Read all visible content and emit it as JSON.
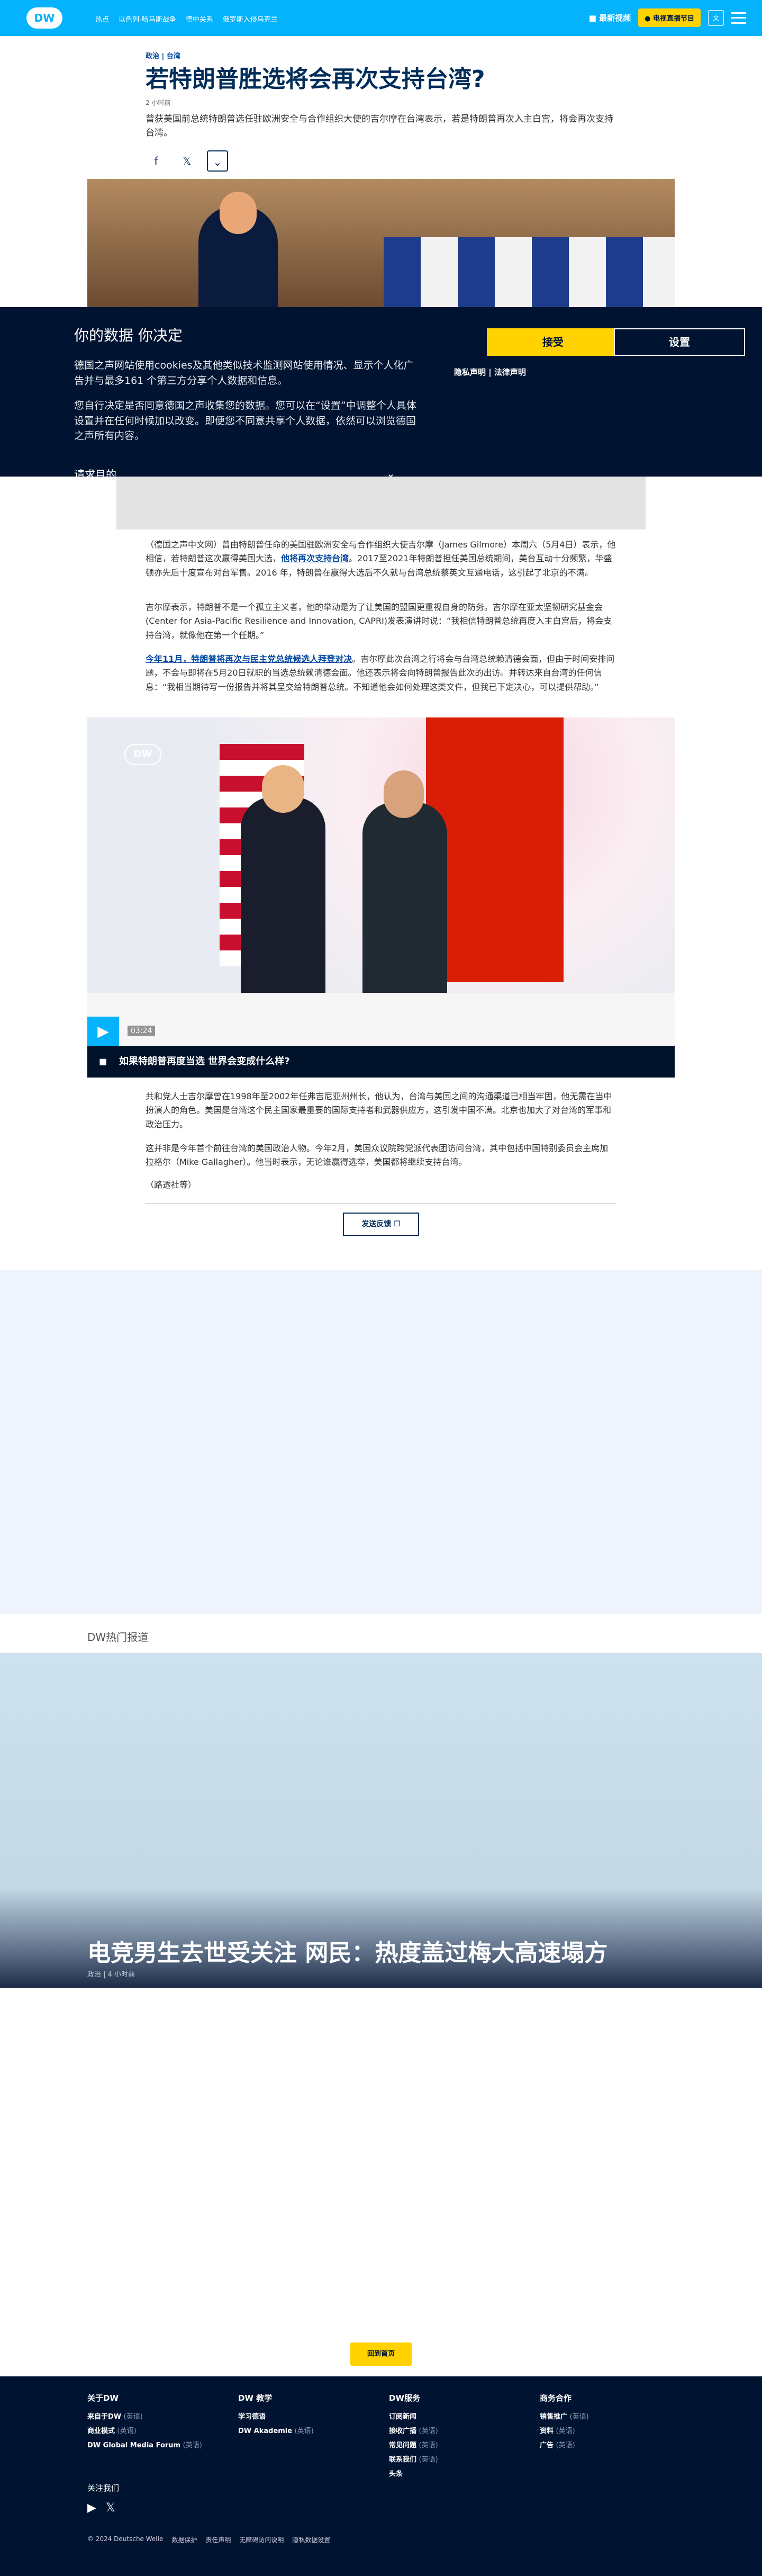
{
  "header": {
    "logo": "DW",
    "nav": [
      "热点",
      "以色列-哈马斯战争",
      "德中关系",
      "俄罗斯入侵乌克兰"
    ],
    "live": "最新视频",
    "radio": "电视直播节目",
    "lang": "文"
  },
  "article": {
    "crumbs": "政治 | 台湾",
    "title": "若特朗普胜选将会再次支持台湾?",
    "time": "2 小时前",
    "lead": "曾获美国前总统特朗普选任驻欧洲安全与合作组织大使的吉尔摩在台湾表示，若是特朗普再次入主白宫，将会再次支持台湾。",
    "share": [
      "f",
      "𝕏",
      "⌄"
    ]
  },
  "consent": {
    "title": "你的数据 你决定",
    "p1": "德国之声网站使用cookies及其他类似技术监测网站使用情况、显示个人化广告并与最多161 个第三方分享个人数据和信息。",
    "p2": "您自行决定是否同意德国之声收集您的数据。您可以在“设置”中调整个人具体设置并在任何时候加以改变。即便您不同意共享个人数据，依然可以浏览德国之声所有内容。",
    "p3": "请求目的",
    "accept": "接受",
    "settings": "设置",
    "legal": "隐私声明 | 法律声明"
  },
  "body": {
    "p1_pre": "（德国之声中文网）曾由特朗普任命的美国驻欧洲安全与合作组织大使吉尔摩（James Gilmore）本周六（5月4日）表示，他相信，若特朗普这次赢得美国大选，",
    "p1_link": "他将再次支持台湾",
    "p1_post": "。2017至2021年特朗普担任美国总统期间，美台互动十分频繁，华盛顿亦先后十度宣布对台军售。2016 年，特朗普在赢得大选后不久就与台湾总统蔡英文互通电话，这引起了北京的不满。",
    "p2": "吉尔摩表示，特朗普不是一个孤立主义者，他的举动是为了让美国的盟国更重视自身的防务。吉尔摩在亚太坚韧研究基金会(Center for Asia-Pacific Resilience and Innovation, CAPRI)发表演讲时说：“我相信特朗普总统再度入主白宫后，将会支持台湾，就像他在第一个任期。”",
    "p3_link": "今年11月，特朗普将再次与民主党总统候选人拜登对决",
    "p3_post": "。吉尔摩此次台湾之行将会与台湾总统赖清德会面，但由于时间安排问题，不会与即将在5月20日就职的当选总统赖清德会面。他还表示将会向特朗普报告此次的出访。并转达来自台湾的任何信息：“我相当期待写一份报告并将其呈交给特朗普总统。不知道他会如何处理这类文件，但我已下定决心，可以提供帮助。”",
    "p4": "共和党人士吉尔摩曾在1998年至2002年任弗吉尼亚州州长，他认为，台湾与美国之间的沟通渠道已相当牢固，他无需在当中扮演人的角色。美国是台湾这个民主国家最重要的国际支持者和武器供应方，这引发中国不满。北京也加大了对台湾的军事和政治压力。",
    "p5": "这并非是今年首个前往台湾的美国政治人物。今年2月，美国众议院跨党派代表团访问台湾，其中包括中国特别委员会主席加拉格尔（Mike Gallagher）。他当时表示，无论谁赢得选举，美国都将继续支持台湾。",
    "p6": "（路透社等）",
    "send": "发送反馈"
  },
  "video": {
    "logo": "DW",
    "duration": "03:24",
    "caption": "如果特朗普再度当选 世界会变成什么样?"
  },
  "popular": {
    "label": "DW热门报道",
    "title": "电竞男生去世受关注 网民：热度盖过梅大高速塌方",
    "meta": "政治 | 4 小时前"
  },
  "backtop": "回到首页",
  "footer": {
    "cols": [
      {
        "h": "关于DW",
        "items": [
          [
            "来自于DW",
            "(英语)"
          ],
          [
            "商业模式",
            "(英语)"
          ],
          [
            "DW Global Media Forum",
            "(英语)"
          ]
        ]
      },
      {
        "h": "DW 教学",
        "items": [
          [
            "学习德语",
            ""
          ],
          [
            "DW Akademie",
            "(英语)"
          ]
        ]
      },
      {
        "h": "DW服务",
        "items": [
          [
            "订阅新闻",
            ""
          ],
          [
            "接收广播",
            "(英语)"
          ],
          [
            "常见问题",
            "(英语)"
          ],
          [
            "联系我们",
            "(英语)"
          ],
          [
            "头条",
            ""
          ]
        ]
      },
      {
        "h": "商务合作",
        "items": [
          [
            "销售推广",
            "(英语)"
          ],
          [
            "资料",
            "(英语)"
          ],
          [
            "广告",
            "(英语)"
          ]
        ]
      }
    ],
    "follow": "关注我们",
    "bottom": [
      "© 2024 Deutsche Welle",
      "数据保护",
      "责任声明",
      "无障碍访问说明",
      "隐私数据设置"
    ]
  }
}
